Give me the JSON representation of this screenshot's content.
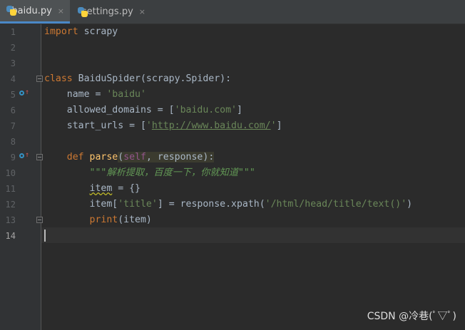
{
  "tabs": [
    {
      "label": "baidu.py",
      "active": true,
      "icon": "python-file-icon"
    },
    {
      "label": "settings.py",
      "active": false,
      "icon": "python-file-icon"
    }
  ],
  "close_glyph": "×",
  "line_numbers": [
    "1",
    "2",
    "3",
    "4",
    "5",
    "6",
    "7",
    "8",
    "9",
    "10",
    "11",
    "12",
    "13",
    "14"
  ],
  "current_line": 14,
  "code": {
    "l1": {
      "kw": "import",
      "rest": " scrapy"
    },
    "l4": {
      "kw": "class",
      "rest": " BaiduSpider(scrapy.Spider):"
    },
    "l5": {
      "name": "    name = ",
      "val": "'baidu'"
    },
    "l6": {
      "name": "    allowed_domains = [",
      "val": "'baidu.com'",
      "end": "]"
    },
    "l7": {
      "name": "    start_urls = [",
      "q1": "'",
      "url": "http://www.baidu.com/",
      "q2": "'",
      "end": "]"
    },
    "l9": {
      "indent": "    ",
      "kw": "def",
      "sp": " ",
      "fn": "parse",
      "open": "(",
      "self": "self",
      "comma": ", response",
      "close": "):"
    },
    "l10": {
      "indent": "        ",
      "doc": "\"\"\"解析提取，百度一下，你就知道\"\"\""
    },
    "l11": {
      "indent": "        ",
      "var": "item",
      "rest": " = {}"
    },
    "l12": {
      "indent": "        ",
      "a": "item[",
      "k": "'title'",
      "b": "] = response.xpath(",
      "x": "'/html/head/title/text()'",
      "c": ")"
    },
    "l13": {
      "indent": "        ",
      "fn": "print",
      "rest": "(item)"
    }
  },
  "colors": {
    "keyword": "#cc7832",
    "string": "#6a8759",
    "function": "#ffc66d",
    "self": "#94558d",
    "background": "#2b2b2b"
  },
  "watermark": "CSDN @冷巷(ﾟ▽ﾟ)"
}
